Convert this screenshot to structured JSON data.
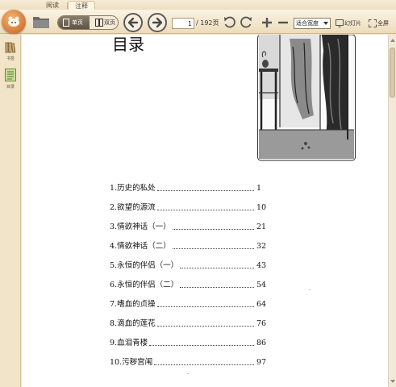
{
  "tabs": [
    {
      "label": "阅读"
    },
    {
      "label": "注释"
    }
  ],
  "toolbar": {
    "single_page": "单页",
    "double_page": "双页",
    "current_page": "1",
    "page_total": "/ 192页",
    "zoom_mode": "适合宽度",
    "slideshow": "幻灯片",
    "fullscreen": "全屏"
  },
  "sidebar": {
    "items": [
      {
        "label": "书签",
        "icon": "bookmark-icon"
      },
      {
        "label": "目录",
        "icon": "toc-icon"
      }
    ]
  },
  "document": {
    "title": "目录",
    "toc": [
      {
        "title": "1.历史的私处",
        "page": "1"
      },
      {
        "title": "2.欲望的源流",
        "page": "10"
      },
      {
        "title": "3.情欲神话（一）",
        "page": "21"
      },
      {
        "title": "4.情欲神话（二）",
        "page": "32"
      },
      {
        "title": "5.永恒的伴侣（一）",
        "page": "43"
      },
      {
        "title": "6.永恒的伴侣（二）",
        "page": "54"
      },
      {
        "title": "7.嗜血的贞操",
        "page": "64"
      },
      {
        "title": "8.滴血的莲花",
        "page": "76"
      },
      {
        "title": "9.血泪青楼",
        "page": "86"
      },
      {
        "title": "10.污秽宫闱",
        "page": "97"
      }
    ]
  },
  "colors": {
    "background": "#f3e7cf",
    "logo": "#d37a36",
    "page": "#ffffff",
    "text": "#111111"
  }
}
